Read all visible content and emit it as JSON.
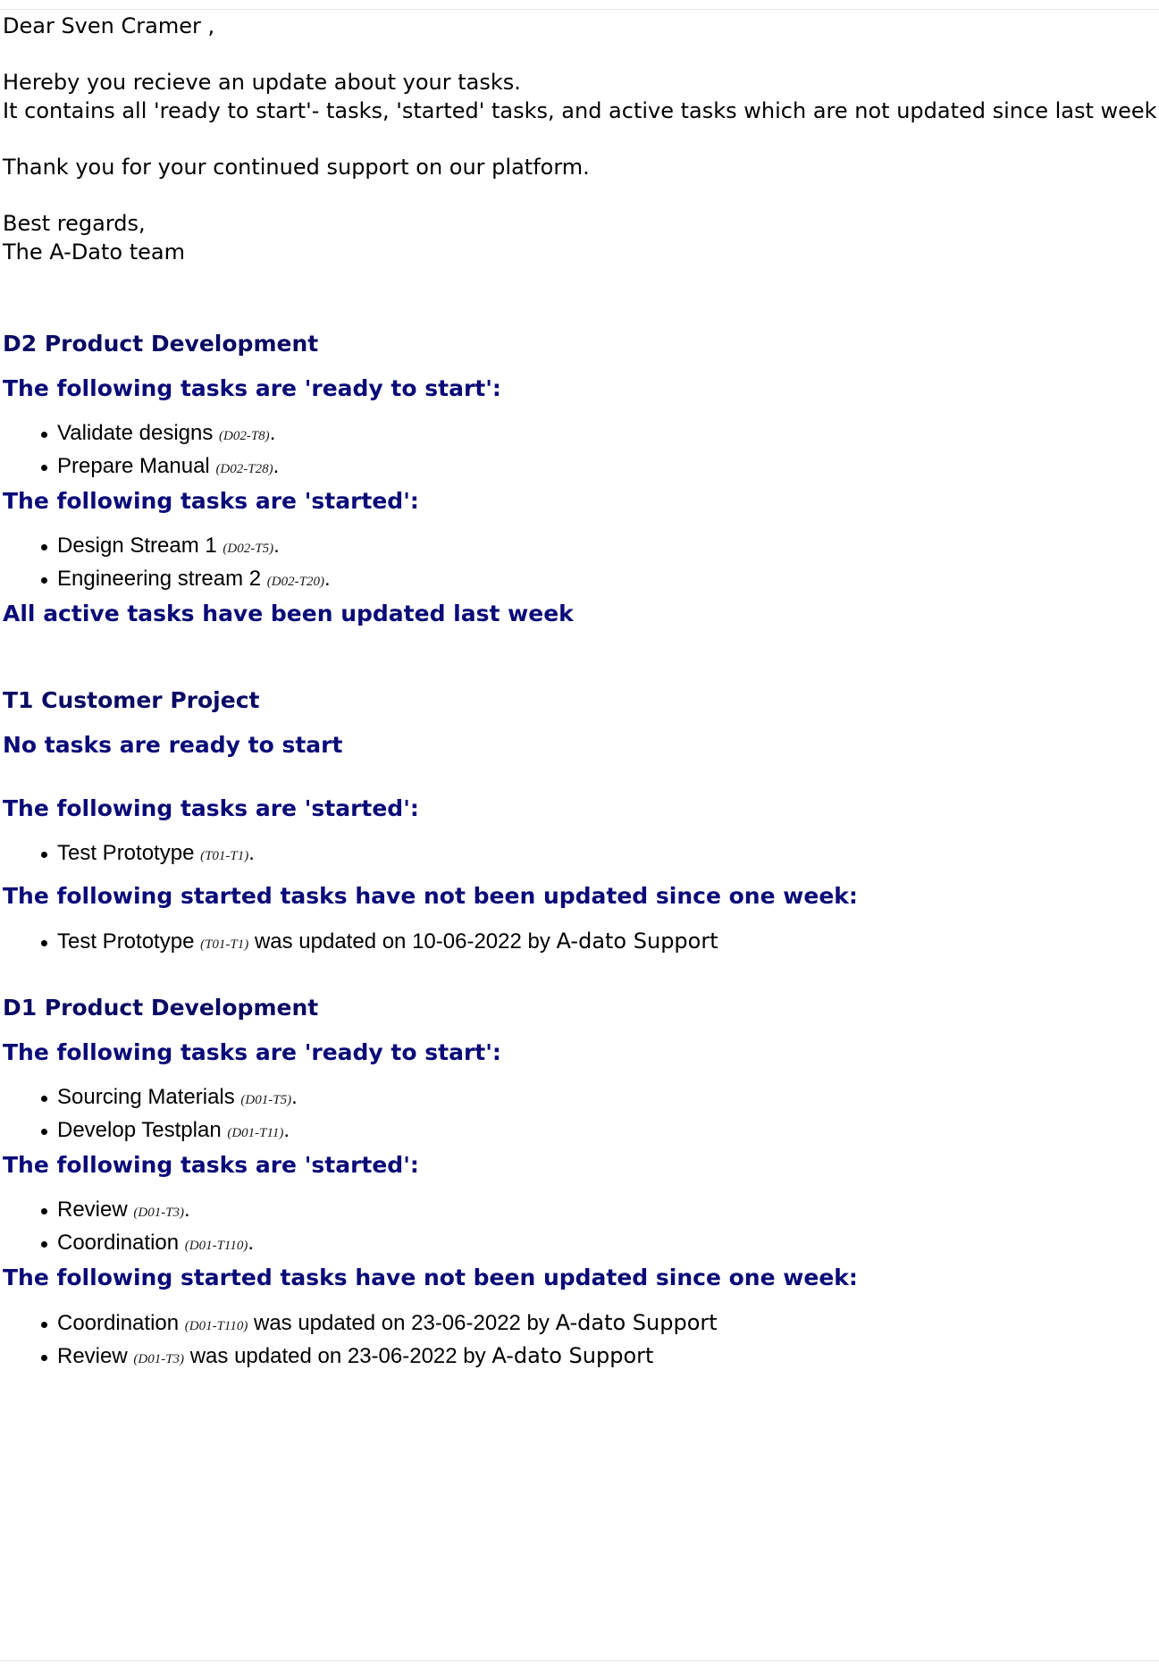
{
  "intro": {
    "greeting": "Dear Sven Cramer ,",
    "line1": "Hereby you recieve an update about your tasks.",
    "line2": "It contains all 'ready to start'- tasks, 'started' tasks, and active tasks which are not updated since last week.",
    "thanks": "Thank you for your continued support on our platform.",
    "regards": "Best regards,",
    "team": "The A-Dato team"
  },
  "projects": [
    {
      "title": "D2 Product Development",
      "ready_heading": "The following tasks are 'ready to start':",
      "ready": [
        {
          "name": "Validate designs",
          "code": "(D02-T8)"
        },
        {
          "name": "Prepare Manual",
          "code": "(D02-T28)"
        }
      ],
      "started_heading": "The following tasks are 'started':",
      "started": [
        {
          "name": "Design Stream 1 ",
          "code": "(D02-T5)"
        },
        {
          "name": "Engineering stream 2 ",
          "code": "(D02-T20)"
        }
      ],
      "stale_heading": "All active tasks have been updated last week"
    },
    {
      "title": "T1 Customer Project",
      "ready_heading": "No tasks are ready to start",
      "started_heading": "The following tasks are 'started':",
      "started": [
        {
          "name": "Test Prototype",
          "code": "(T01-T1)"
        }
      ],
      "stale_heading": "The following started tasks have not been updated since one week:",
      "stale": [
        {
          "name": "Test Prototype",
          "code": "(T01-T1)",
          "updated": "was updated on 10-06-2022 by ",
          "by": "A-dato Support"
        }
      ]
    },
    {
      "title": "D1 Product Development",
      "ready_heading": "The following tasks are 'ready to start':",
      "ready": [
        {
          "name": "Sourcing Materials",
          "code": "(D01-T5)"
        },
        {
          "name": "Develop Testplan",
          "code": "(D01-T11)"
        }
      ],
      "started_heading": "The following tasks are 'started':",
      "started": [
        {
          "name": "Review",
          "code": "(D01-T3)"
        },
        {
          "name": "Coordination",
          "code": "(D01-T110)"
        }
      ],
      "stale_heading": "The following started tasks have not been updated since one week:",
      "stale": [
        {
          "name": "Coordination",
          "code": "(D01-T110)",
          "updated": "was updated on 23-06-2022 by ",
          "by": "A-dato Support"
        },
        {
          "name": "Review",
          "code": "(D01-T3)",
          "updated": "was updated on 23-06-2022 by ",
          "by": "A-dato Support"
        }
      ]
    }
  ]
}
